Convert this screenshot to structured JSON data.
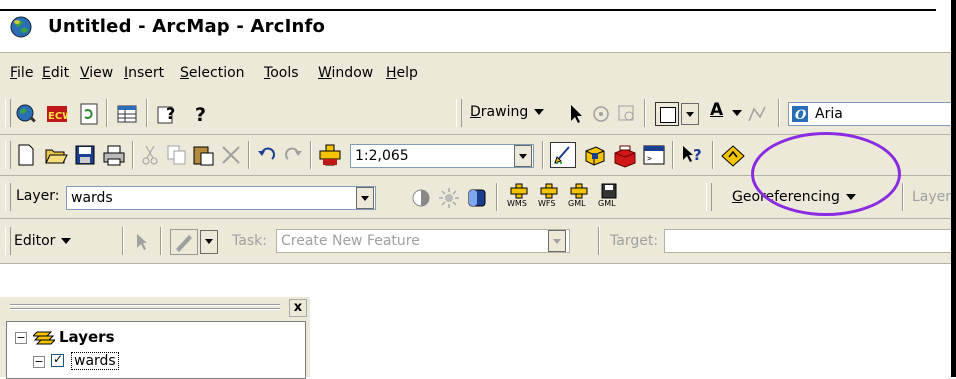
{
  "window": {
    "title": "Untitled - ArcMap - ArcInfo"
  },
  "menu": [
    {
      "label": "File",
      "mnemonic": "F",
      "rest": "ile"
    },
    {
      "label": "Edit",
      "mnemonic": "E",
      "rest": "dit"
    },
    {
      "label": "View",
      "mnemonic": "V",
      "rest": "iew"
    },
    {
      "label": "Insert",
      "mnemonic": "I",
      "rest": "nsert"
    },
    {
      "label": "Selection",
      "mnemonic": "S",
      "rest": "election"
    },
    {
      "label": "Tools",
      "mnemonic": "T",
      "rest": "ools"
    },
    {
      "label": "Window",
      "mnemonic": "W",
      "rest": "indow"
    },
    {
      "label": "Help",
      "mnemonic": "H",
      "rest": "elp"
    }
  ],
  "toolbar1": {
    "drawing_label": "Drawing",
    "drawing_mnemonic": "D",
    "drawing_rest": "rawing",
    "font_field": "Aria"
  },
  "toolbar2": {
    "scale_value": "1:2,065"
  },
  "toolbar3": {
    "layer_label": "Layer:",
    "layer_value": "wards",
    "georef_label": "Georeferencing",
    "georef_mnemonic": "G",
    "georef_rest": "eoreferencing",
    "layer_cut": "Layer",
    "wms": "WMS",
    "wfs": "WFS",
    "gml1": "GML",
    "gml2": "GML"
  },
  "editor": {
    "editor_label": "Editor",
    "task_label": "Task:",
    "task_value": "Create New Feature",
    "target_label": "Target:"
  },
  "toc": {
    "close": "x",
    "layers": "Layers",
    "layer_item": "wards",
    "expand_symbol": "−"
  },
  "colors": {
    "highlight_circle": "#8a2be2"
  }
}
